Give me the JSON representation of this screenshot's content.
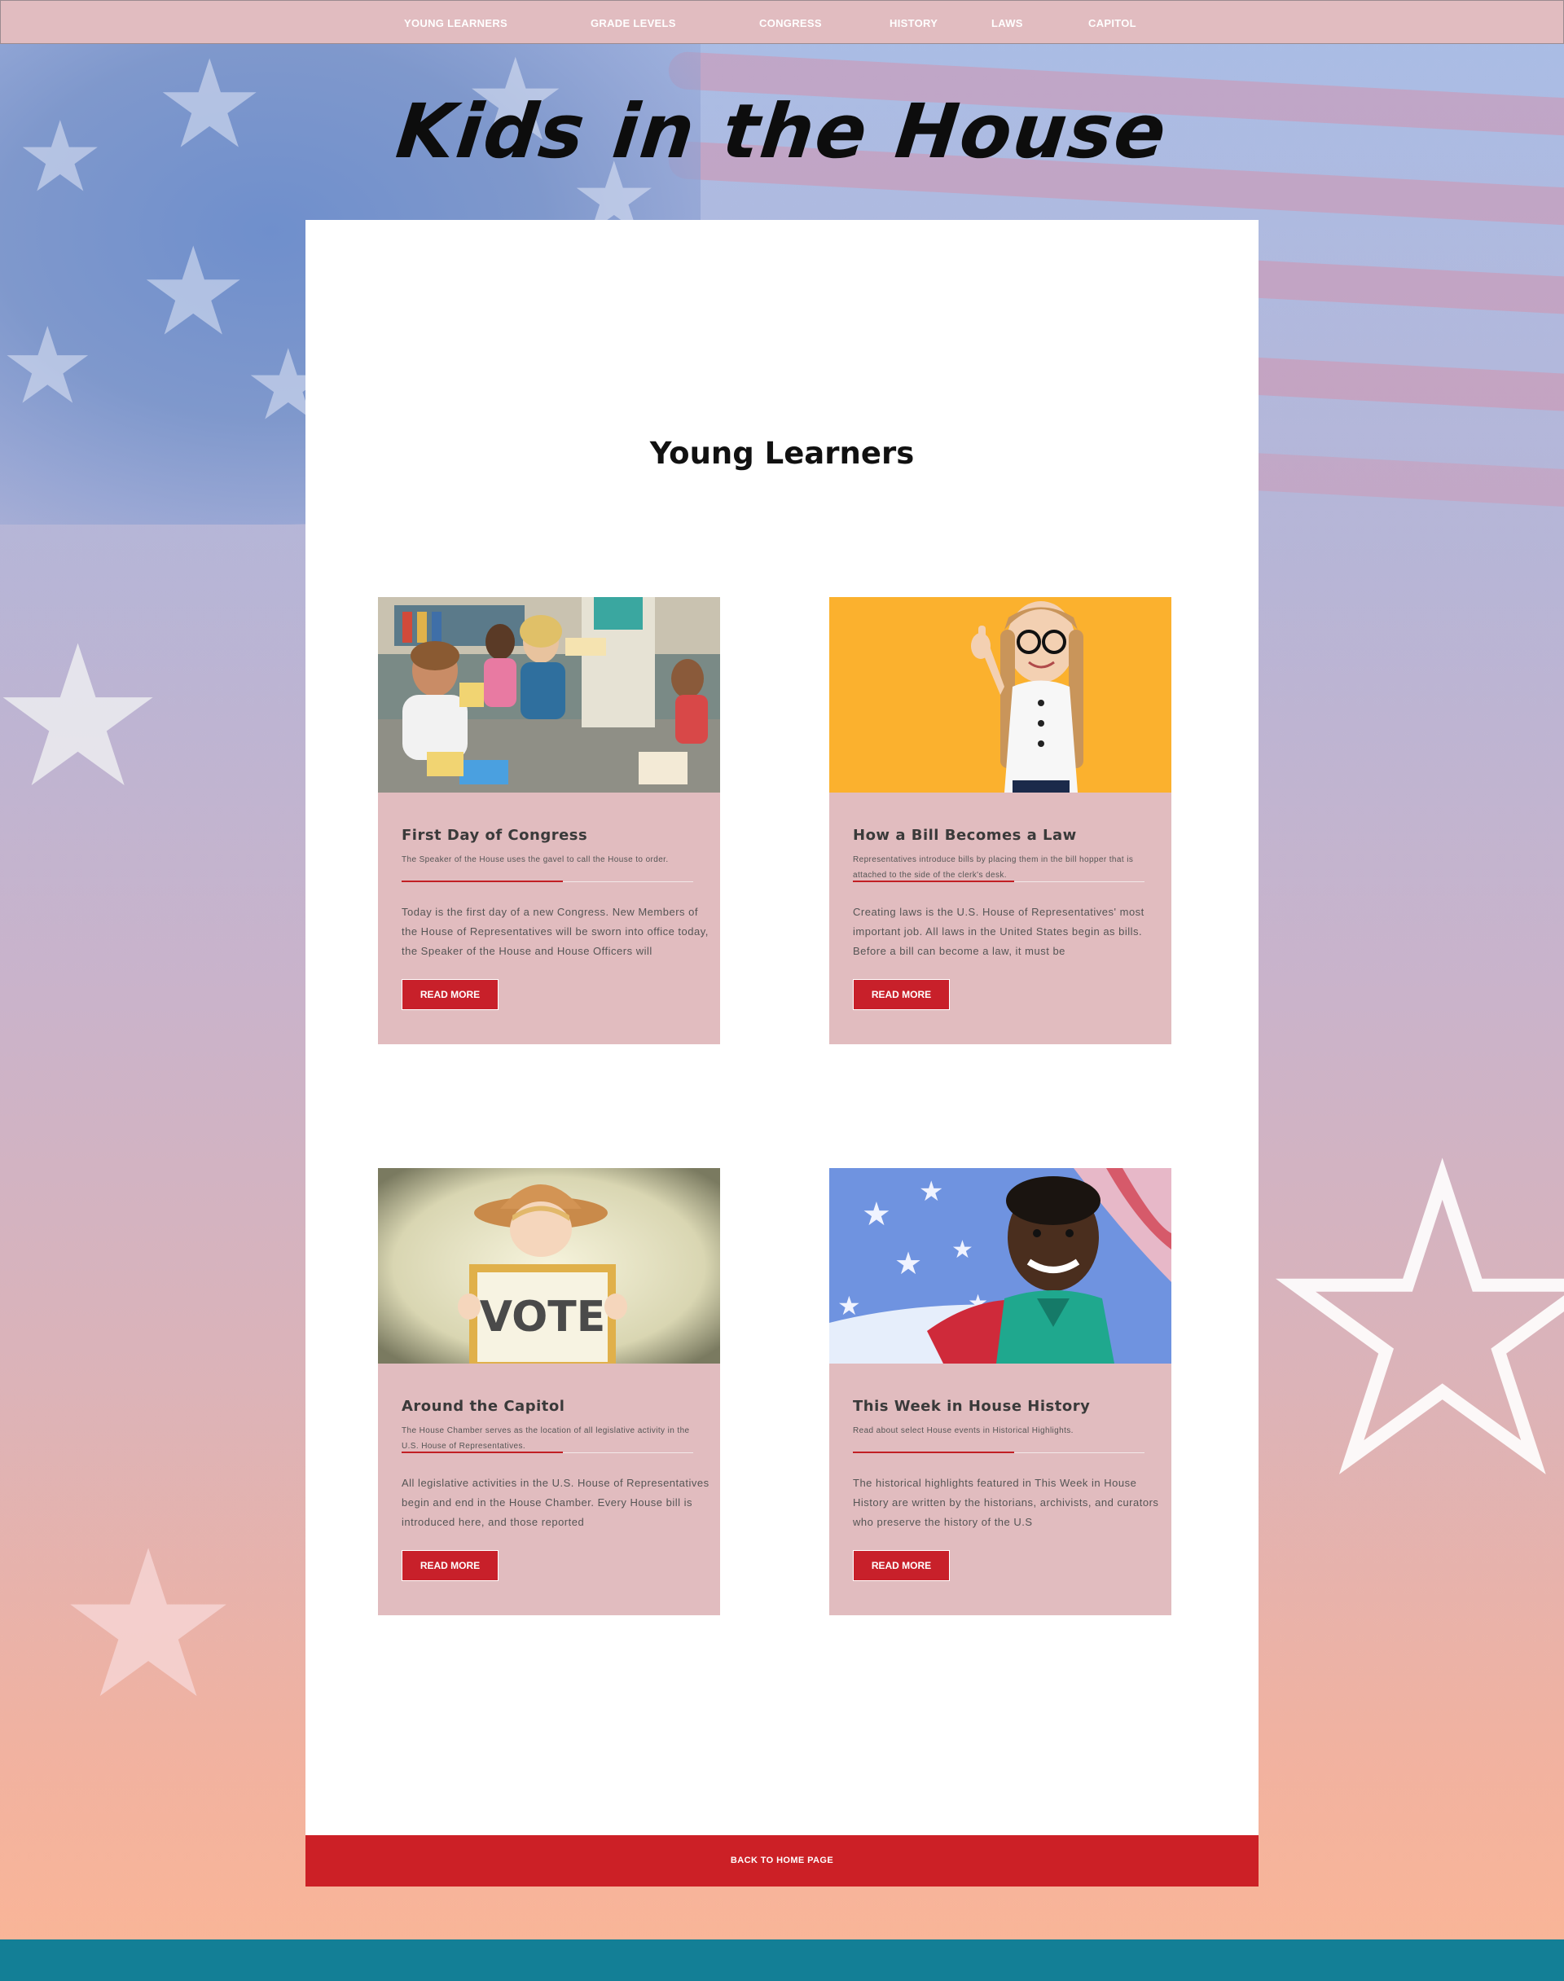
{
  "nav": {
    "items": [
      {
        "label": "YOUNG LEARNERS"
      },
      {
        "label": "GRADE LEVELS"
      },
      {
        "label": "CONGRESS"
      },
      {
        "label": "HISTORY"
      },
      {
        "label": "LAWS"
      },
      {
        "label": "CAPITOL"
      }
    ]
  },
  "site": {
    "title": "Kids in the House"
  },
  "section": {
    "title": "Young Learners"
  },
  "cards": [
    {
      "title": "First Day of Congress",
      "subtitle": "The Speaker of the House uses the gavel to call the House to order.",
      "body": "Today is the first day of a new Congress. New Members of the House of Representatives will be sworn into office today, the Speaker of the House and House Officers will",
      "button": "READ MORE"
    },
    {
      "title": "How a Bill Becomes a Law",
      "subtitle": "Representatives introduce bills by placing them in the bill hopper that is attached to the side of the clerk's desk.",
      "body": "Creating laws is the U.S. House of Representatives' most important job. All laws in the United States begin as bills. Before a bill can become a law, it must be",
      "button": "READ MORE"
    },
    {
      "title": "Around the Capitol",
      "subtitle": "The House Chamber serves as the location of all legislative activity in the U.S. House of Representatives.",
      "body": "All legislative activities in the U.S. House of Representatives begin and end in the House Chamber. Every House bill is introduced here, and those reported",
      "button": "READ MORE",
      "image_text": "VOTE"
    },
    {
      "title": "This Week in House History",
      "subtitle": "Read about select House events in Historical Highlights.",
      "body": "The historical highlights featured in This Week in House History are written by the historians, archivists, and curators who preserve the history of the U.S",
      "button": "READ MORE"
    }
  ],
  "footer": {
    "back_home": "BACK TO HOME PAGE"
  },
  "colors": {
    "nav_bg": "#e1bcc0",
    "card_bg": "#e1bcbf",
    "accent_red": "#c8202a",
    "footer_teal": "#137f96",
    "panel_bg": "#ffffff"
  }
}
